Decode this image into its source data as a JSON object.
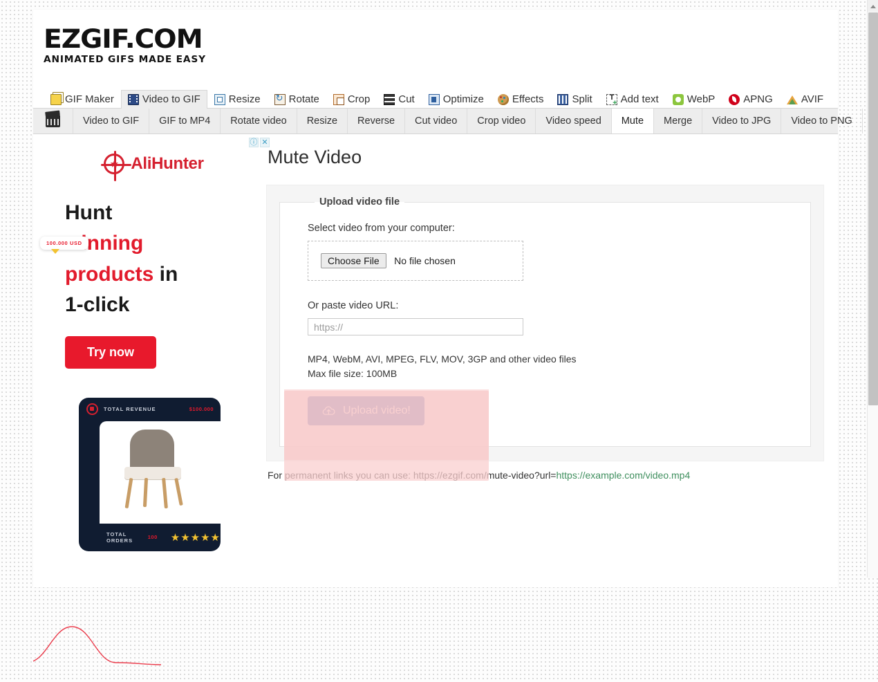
{
  "brand": {
    "logo_main": "EZGIF.COM",
    "logo_sub": "ANIMATED GIFS MADE EASY"
  },
  "nav_primary": {
    "items": [
      {
        "label": "GIF Maker",
        "icon": "gif-maker-icon",
        "active": false
      },
      {
        "label": "Video to GIF",
        "icon": "video-film-icon",
        "active": true
      },
      {
        "label": "Resize",
        "icon": "resize-icon",
        "active": false
      },
      {
        "label": "Rotate",
        "icon": "rotate-icon",
        "active": false
      },
      {
        "label": "Crop",
        "icon": "crop-icon",
        "active": false
      },
      {
        "label": "Cut",
        "icon": "cut-icon",
        "active": false
      },
      {
        "label": "Optimize",
        "icon": "optimize-icon",
        "active": false
      },
      {
        "label": "Effects",
        "icon": "effects-palette-icon",
        "active": false
      },
      {
        "label": "Split",
        "icon": "split-icon",
        "active": false
      },
      {
        "label": "Add text",
        "icon": "add-text-icon",
        "active": false
      },
      {
        "label": "WebP",
        "icon": "webp-icon",
        "active": false
      },
      {
        "label": "APNG",
        "icon": "apng-icon",
        "active": false
      },
      {
        "label": "AVIF",
        "icon": "avif-icon",
        "active": false
      }
    ]
  },
  "nav_secondary": {
    "home_icon": "clapperboard-icon",
    "items": [
      {
        "label": "Video to GIF",
        "active": false
      },
      {
        "label": "GIF to MP4",
        "active": false
      },
      {
        "label": "Rotate video",
        "active": false
      },
      {
        "label": "Resize",
        "active": false
      },
      {
        "label": "Reverse",
        "active": false
      },
      {
        "label": "Cut video",
        "active": false
      },
      {
        "label": "Crop video",
        "active": false
      },
      {
        "label": "Video speed",
        "active": false
      },
      {
        "label": "Mute",
        "active": true
      },
      {
        "label": "Merge",
        "active": false
      },
      {
        "label": "Video to JPG",
        "active": false
      },
      {
        "label": "Video to PNG",
        "active": false
      }
    ]
  },
  "ad": {
    "info_badge": "ⓘ",
    "close_badge": "✕",
    "brand_name": "AliHunter",
    "headline_1": "Hunt",
    "headline_2": "winning",
    "headline_3": "products",
    "headline_3_tail": " in",
    "headline_4": "1-click",
    "cta_label": "Try now",
    "card": {
      "revenue_label": "TOTAL REVENUE",
      "revenue_value": "$100.000",
      "orders_label": "TOTAL ORDERS",
      "orders_value": "100",
      "stars": "★★★★★",
      "pill_value": "100.000 USD"
    }
  },
  "main": {
    "title": "Mute Video",
    "fieldset_legend": "Upload video file",
    "file_label": "Select video from your computer:",
    "choose_file_button": "Choose File",
    "no_file_text": "No file chosen",
    "url_label": "Or paste video URL:",
    "url_value": "",
    "url_placeholder": "https://",
    "formats_hint": "MP4, WebM, AVI, MPEG, FLV, MOV, 3GP and other video files",
    "maxsize_hint": "Max file size: 100MB",
    "upload_button": "Upload video!",
    "upload_icon": "cloud-upload-icon",
    "permalink_prefix": "For permanent links you can use: https://ezgif.com/mute-video?url=",
    "permalink_url": "https://example.com/video.mp4"
  },
  "colors": {
    "accent_blue": "#2b57ae",
    "ad_red": "#e8192c",
    "link_green": "#3f8f5e",
    "highlight_pink": "#f9cfcf",
    "active_tab_bg": "#ffffff"
  }
}
